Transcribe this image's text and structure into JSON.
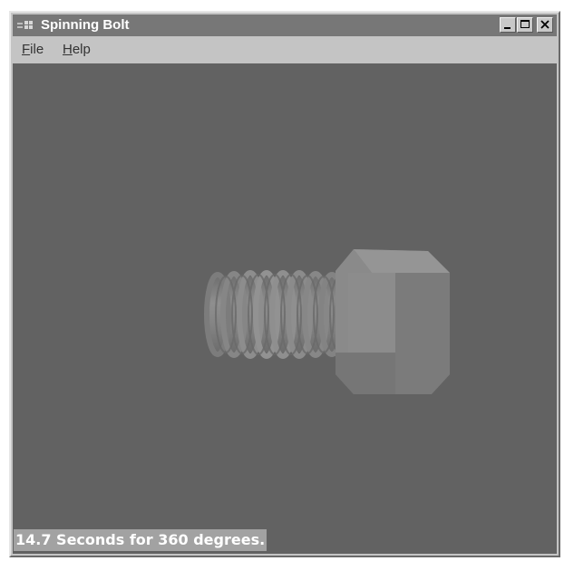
{
  "window": {
    "title": "Spinning Bolt",
    "buttons": {
      "minimize": "minimize-icon",
      "maximize": "maximize-icon",
      "close": "close-icon"
    }
  },
  "menu": {
    "items": [
      {
        "label": "File",
        "mnemonic": "F"
      },
      {
        "label": "Help",
        "mnemonic": "H"
      }
    ]
  },
  "viewport": {
    "object": "hex-bolt",
    "background_color": "#626262",
    "status": "14.7 Seconds for 360 degrees."
  }
}
